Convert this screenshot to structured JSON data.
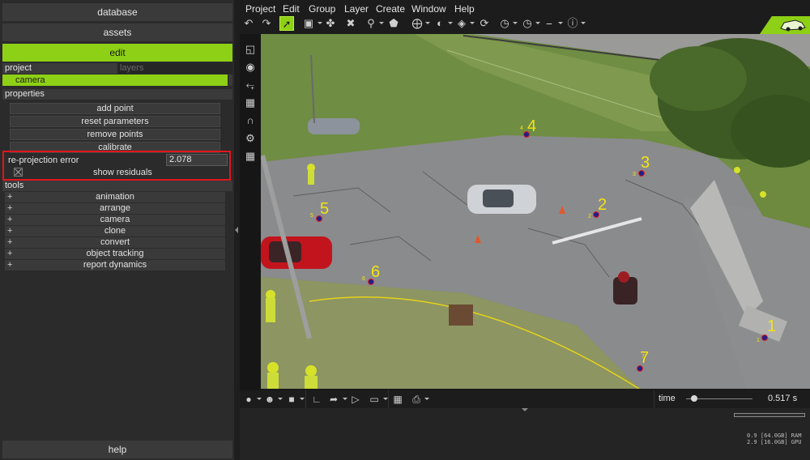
{
  "left_panel": {
    "nav": {
      "database": "database",
      "assets": "assets",
      "edit": "edit"
    },
    "tabs": {
      "project": "project",
      "layers": "layers"
    },
    "tree": {
      "selected_item": "camera"
    },
    "properties": {
      "header": "properties",
      "buttons": [
        "add point",
        "reset parameters",
        "remove points",
        "calibrate"
      ],
      "reprojection_label": "re-projection error",
      "reprojection_value": "2.078",
      "show_residuals_label": "show residuals",
      "show_residuals_checked": true
    },
    "tools": {
      "header": "tools",
      "items": [
        "animation",
        "arrange",
        "camera",
        "clone",
        "convert",
        "object tracking",
        "report dynamics"
      ],
      "expand_glyph": "+"
    },
    "help": "help"
  },
  "menubar": {
    "items": [
      "Project",
      "Edit",
      "Group",
      "Layer",
      "Create",
      "Window",
      "Help"
    ]
  },
  "toolbar": {
    "icons": [
      "undo-icon",
      "redo-icon",
      "select-arrow-icon",
      "frame-icon",
      "transform-icon",
      "delete-icon",
      "search-icon",
      "polygon-icon",
      "move-icon",
      "sphere-tool-icon",
      "plane-tool-icon",
      "rotate-icon",
      "gauge-icon",
      "measure-icon",
      "help-circle-icon"
    ]
  },
  "sidebar_tools": [
    "camera-view-icon",
    "target-icon",
    "axis-icon",
    "filmstrip-icon",
    "magnet-icon",
    "gears-icon",
    "grid-icon"
  ],
  "viewport": {
    "markers": [
      {
        "id": "1",
        "sub": "1"
      },
      {
        "id": "2",
        "sub": "2"
      },
      {
        "id": "3",
        "sub": "3"
      },
      {
        "id": "4",
        "sub": "4"
      },
      {
        "id": "5",
        "sub": "5"
      },
      {
        "id": "6",
        "sub": "6"
      },
      {
        "id": "7",
        "sub": "7"
      }
    ],
    "marker_color": "#f3e312"
  },
  "bottombar": {
    "time_label": "time",
    "time_value": "0.517 s",
    "progress": 0.1
  },
  "status": {
    "ram": "0.9 [64.0GB] RAM",
    "gpu": "2.9 [16.0GB] GPU"
  },
  "colors": {
    "accent": "#8ed015",
    "highlight_border": "#e0161d"
  }
}
